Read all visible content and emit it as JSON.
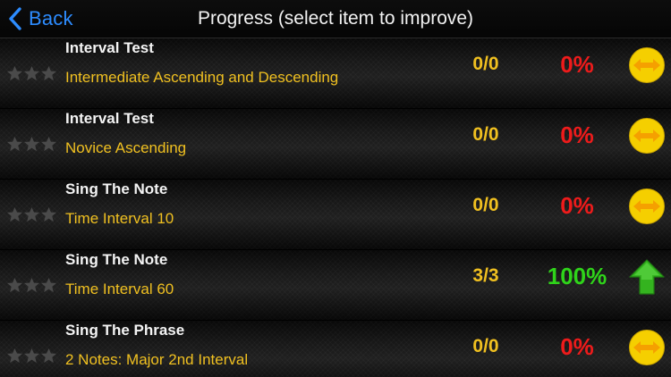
{
  "navbar": {
    "back_label": "Back",
    "title": "Progress (select item to improve)"
  },
  "colors": {
    "accent_blue": "#2d8cff",
    "subtitle_yellow": "#f0c020",
    "percent_red": "#ee1b1b",
    "percent_green": "#2fd41a",
    "trend_circle_yellow": "#f5cf00",
    "trend_arrow_orange": "#f5a000"
  },
  "rows": [
    {
      "title": "Interval Test",
      "subtitle": "Intermediate Ascending and Descending",
      "score": "0/0",
      "percent": "0%",
      "stars": 0,
      "trend": "neutral-arrows-icon"
    },
    {
      "title": "Interval Test",
      "subtitle": "Novice Ascending",
      "score": "0/0",
      "percent": "0%",
      "stars": 0,
      "trend": "neutral-arrows-icon"
    },
    {
      "title": "Sing The Note",
      "subtitle": "Time Interval 10",
      "score": "0/0",
      "percent": "0%",
      "stars": 0,
      "trend": "neutral-arrows-icon"
    },
    {
      "title": "Sing The Note",
      "subtitle": "Time Interval 60",
      "score": "3/3",
      "percent": "100%",
      "stars": 0,
      "trend": "up-arrow-icon"
    },
    {
      "title": "Sing The Phrase",
      "subtitle": "2 Notes: Major 2nd Interval",
      "score": "0/0",
      "percent": "0%",
      "stars": 0,
      "trend": "neutral-arrows-icon"
    }
  ]
}
